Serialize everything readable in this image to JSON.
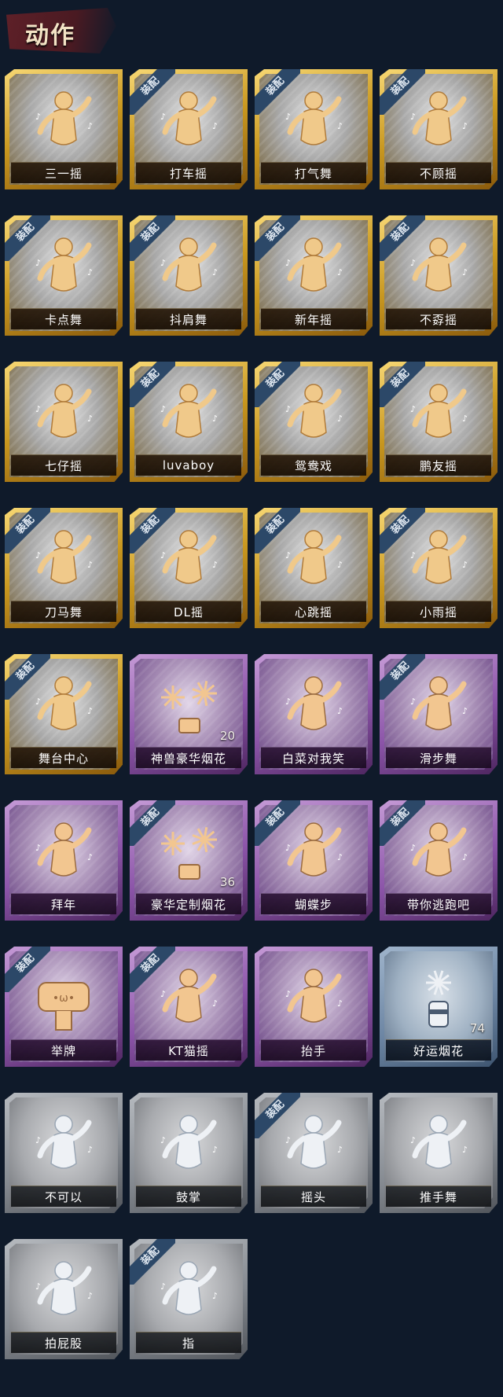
{
  "header": {
    "title": "动作"
  },
  "equip_label": "装配",
  "actions": [
    {
      "label": "三一摇",
      "tier": "gold",
      "equipped": false,
      "icon": "dance-figure-icon"
    },
    {
      "label": "打车摇",
      "tier": "gold",
      "equipped": true,
      "icon": "dance-figure-icon"
    },
    {
      "label": "打气舞",
      "tier": "gold",
      "equipped": true,
      "icon": "dance-figure-icon"
    },
    {
      "label": "不顾摇",
      "tier": "gold",
      "equipped": true,
      "icon": "dance-figure-icon"
    },
    {
      "label": "卡点舞",
      "tier": "gold",
      "equipped": true,
      "icon": "dance-figure-icon"
    },
    {
      "label": "抖肩舞",
      "tier": "gold",
      "equipped": true,
      "icon": "dance-figure-icon"
    },
    {
      "label": "新年摇",
      "tier": "gold",
      "equipped": true,
      "icon": "dance-figure-icon"
    },
    {
      "label": "不孬摇",
      "tier": "gold",
      "equipped": true,
      "icon": "dance-figure-icon"
    },
    {
      "label": "七仔摇",
      "tier": "gold",
      "equipped": false,
      "icon": "dance-figure-icon"
    },
    {
      "label": "luvaboy",
      "tier": "gold",
      "equipped": true,
      "icon": "dance-figure-icon"
    },
    {
      "label": "鸳鸯戏",
      "tier": "gold",
      "equipped": true,
      "icon": "dance-figure-icon"
    },
    {
      "label": "鹏友摇",
      "tier": "gold",
      "equipped": true,
      "icon": "dance-figure-icon"
    },
    {
      "label": "刀马舞",
      "tier": "gold",
      "equipped": true,
      "icon": "dance-figure-icon"
    },
    {
      "label": "DL摇",
      "tier": "gold",
      "equipped": true,
      "icon": "dance-figure-icon"
    },
    {
      "label": "心跳摇",
      "tier": "gold",
      "equipped": true,
      "icon": "dance-figure-icon"
    },
    {
      "label": "小雨摇",
      "tier": "gold",
      "equipped": true,
      "icon": "dance-figure-icon"
    },
    {
      "label": "舞台中心",
      "tier": "gold",
      "equipped": true,
      "icon": "dance-figure-icon"
    },
    {
      "label": "神兽豪华烟花",
      "tier": "purple",
      "equipped": false,
      "icon": "firework-icon",
      "count": "20"
    },
    {
      "label": "白菜对我笑",
      "tier": "purple",
      "equipped": false,
      "icon": "dance-figure-icon"
    },
    {
      "label": "滑步舞",
      "tier": "purple",
      "equipped": true,
      "icon": "dance-figure-icon"
    },
    {
      "label": "拜年",
      "tier": "purple",
      "equipped": false,
      "icon": "bow-figure-icon"
    },
    {
      "label": "豪华定制烟花",
      "tier": "purple",
      "equipped": true,
      "icon": "firework-icon",
      "count": "36"
    },
    {
      "label": "蝴蝶步",
      "tier": "purple",
      "equipped": true,
      "icon": "dance-figure-icon"
    },
    {
      "label": "带你逃跑吧",
      "tier": "purple",
      "equipped": true,
      "icon": "dance-figure-icon"
    },
    {
      "label": "举牌",
      "tier": "purple",
      "equipped": true,
      "icon": "sign-board-icon"
    },
    {
      "label": "KT猫摇",
      "tier": "purple",
      "equipped": true,
      "icon": "dance-figure-icon"
    },
    {
      "label": "抬手",
      "tier": "purple",
      "equipped": false,
      "icon": "raise-hand-icon"
    },
    {
      "label": "好运烟花",
      "tier": "blue",
      "equipped": false,
      "icon": "firework-can-icon",
      "count": "74"
    },
    {
      "label": "不可以",
      "tier": "gray",
      "equipped": false,
      "icon": "finger-wag-icon"
    },
    {
      "label": "鼓掌",
      "tier": "gray",
      "equipped": false,
      "icon": "clap-icon"
    },
    {
      "label": "摇头",
      "tier": "gray",
      "equipped": true,
      "icon": "head-shake-icon"
    },
    {
      "label": "推手舞",
      "tier": "gray",
      "equipped": false,
      "icon": "dance-figure-icon"
    },
    {
      "label": "拍屁股",
      "tier": "gray",
      "equipped": false,
      "icon": "dance-figure-icon"
    },
    {
      "label": "指",
      "tier": "gray",
      "equipped": true,
      "icon": "point-icon"
    }
  ],
  "colors": {
    "background": "#0f1a2a",
    "gold": "#d9a92e",
    "purple": "#8b54a8",
    "blue": "#6d86a4",
    "gray": "#868b92",
    "badge": "#2c4868"
  }
}
